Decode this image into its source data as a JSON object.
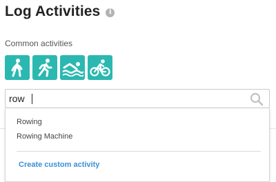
{
  "header": {
    "title": "Log Activities",
    "info_icon": "info-icon",
    "info_glyph": "i"
  },
  "common": {
    "label": "Common activities",
    "items": [
      {
        "icon": "walking-icon"
      },
      {
        "icon": "running-icon"
      },
      {
        "icon": "swimming-icon"
      },
      {
        "icon": "cycling-icon"
      }
    ],
    "accent": "#2bb8b1"
  },
  "search": {
    "value": "row",
    "icon": "search-icon"
  },
  "suggestions": {
    "items": [
      "Rowing",
      "Rowing Machine"
    ],
    "custom_label": "Create custom activity",
    "link_color": "#3b8fd6"
  }
}
